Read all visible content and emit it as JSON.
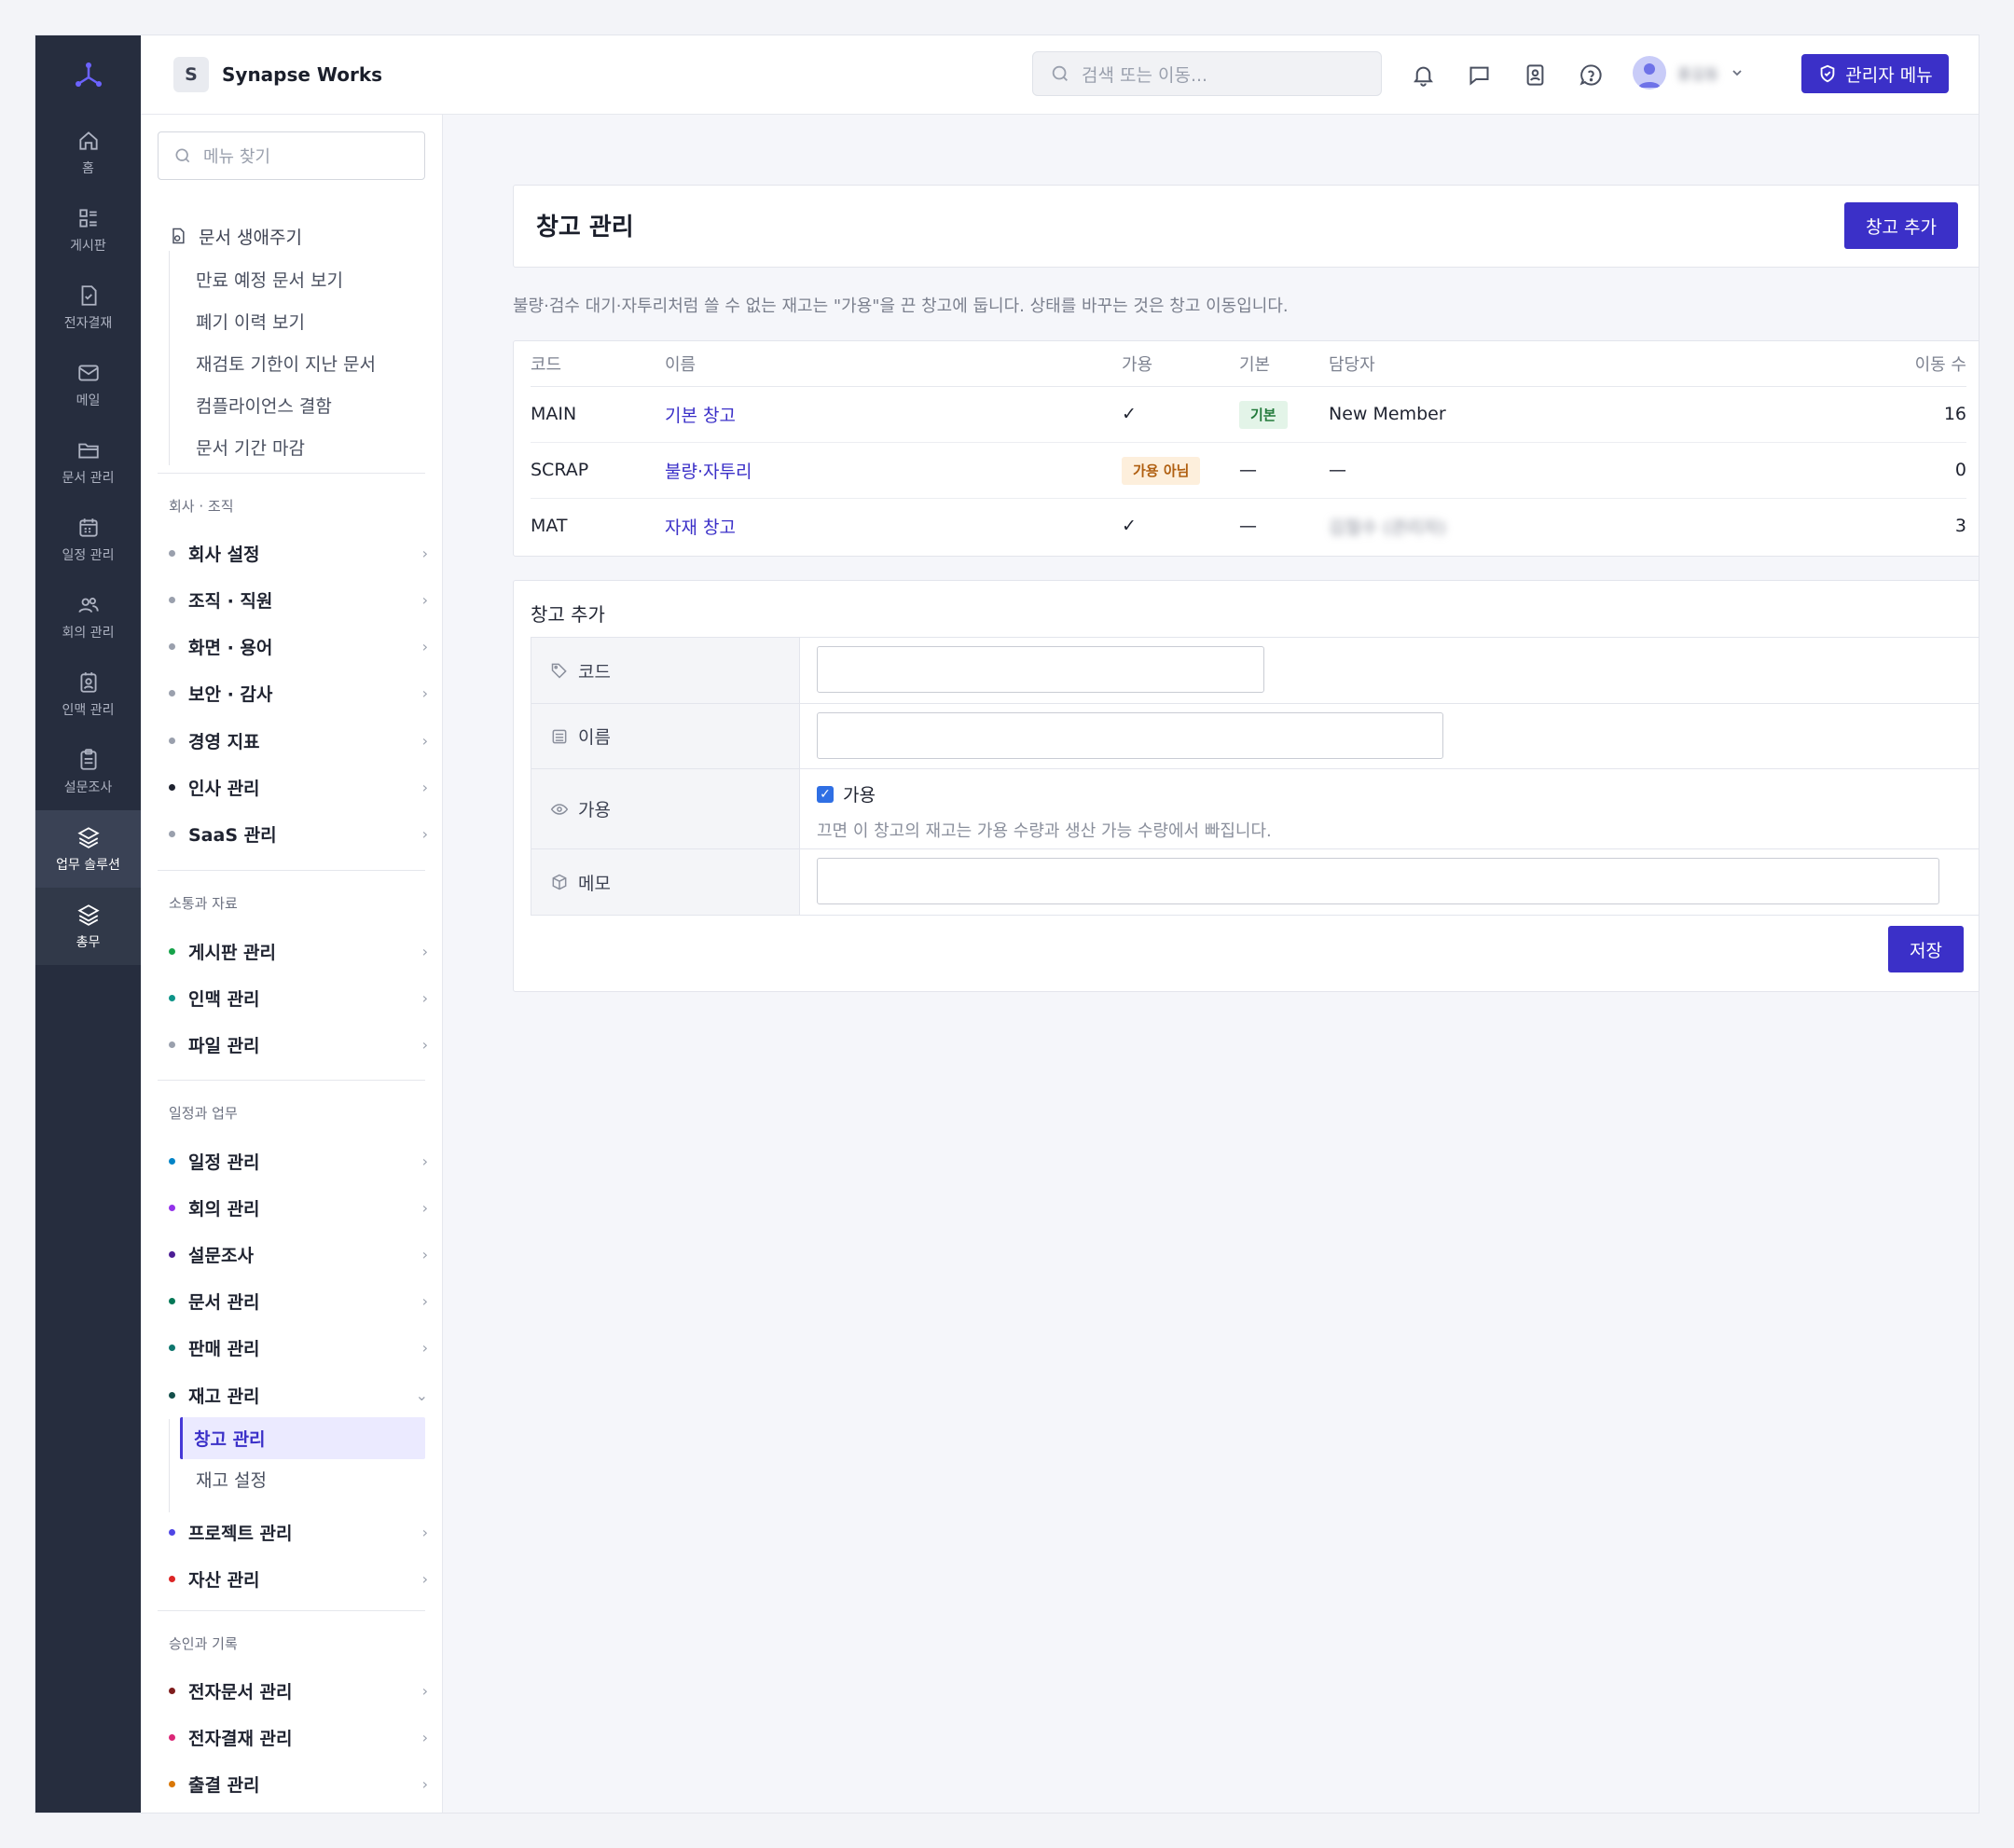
{
  "company": {
    "initial": "S",
    "name": "Synapse Works"
  },
  "search": {
    "placeholder": "검색 또는 이동..."
  },
  "user": {
    "name": "홍길동"
  },
  "admin_button": "관리자 메뉴",
  "rail": [
    {
      "icon": "home-icon",
      "label": "홈"
    },
    {
      "icon": "board-icon",
      "label": "게시판"
    },
    {
      "icon": "approval-icon",
      "label": "전자결재"
    },
    {
      "icon": "mail-icon",
      "label": "메일"
    },
    {
      "icon": "folder-icon",
      "label": "문서 관리"
    },
    {
      "icon": "calendar-icon",
      "label": "일정 관리"
    },
    {
      "icon": "users-icon",
      "label": "회의 관리"
    },
    {
      "icon": "contact-icon",
      "label": "인맥 관리"
    },
    {
      "icon": "clipboard-icon",
      "label": "설문조사"
    },
    {
      "icon": "layers-icon",
      "label": "업무 솔루션"
    },
    {
      "icon": "layers-icon",
      "label": "총무"
    }
  ],
  "menu": {
    "search_placeholder": "메뉴 찾기",
    "lifecycle": {
      "title": "문서 생애주기",
      "items": [
        "만료 예정 문서 보기",
        "폐기 이력 보기",
        "재검토 기한이 지난 문서",
        "컴플라이언스 결함",
        "문서 기간 마감"
      ]
    },
    "groups": [
      {
        "title": "회사 · 조직",
        "items": [
          {
            "label": "회사 설정",
            "color": "#9aa0ad"
          },
          {
            "label": "조직 · 직원",
            "color": "#9aa0ad"
          },
          {
            "label": "화면 · 용어",
            "color": "#9aa0ad"
          },
          {
            "label": "보안 · 감사",
            "color": "#9aa0ad"
          },
          {
            "label": "경영 지표",
            "color": "#9aa0ad"
          },
          {
            "label": "인사 관리",
            "color": "#1f2330"
          },
          {
            "label": "SaaS 관리",
            "color": "#9aa0ad"
          }
        ]
      },
      {
        "title": "소통과 자료",
        "items": [
          {
            "label": "게시판 관리",
            "color": "#16a34a"
          },
          {
            "label": "인맥 관리",
            "color": "#0d9488"
          },
          {
            "label": "파일 관리",
            "color": "#9aa0ad"
          }
        ]
      },
      {
        "title": "일정과 업무",
        "items": [
          {
            "label": "일정 관리",
            "color": "#0284c7"
          },
          {
            "label": "회의 관리",
            "color": "#9333ea"
          },
          {
            "label": "설문조사",
            "color": "#4c1d95"
          },
          {
            "label": "문서 관리",
            "color": "#047857"
          },
          {
            "label": "판매 관리",
            "color": "#0f766e"
          },
          {
            "label": "재고 관리",
            "color": "#134e4a"
          },
          {
            "label": "프로젝트 관리",
            "color": "#4f46e5"
          },
          {
            "label": "자산 관리",
            "color": "#dc2626"
          }
        ]
      },
      {
        "title": "승인과 기록",
        "items": [
          {
            "label": "전자문서 관리",
            "color": "#7f1d1d"
          },
          {
            "label": "전자결재 관리",
            "color": "#db2777"
          },
          {
            "label": "출결 관리",
            "color": "#d97706"
          }
        ]
      }
    ],
    "inventory_sub": [
      "창고 관리",
      "재고 설정"
    ]
  },
  "page": {
    "title": "창고 관리",
    "add_button": "창고 추가",
    "description": "불량·검수 대기·자투리처럼 쓸 수 없는 재고는 \"가용\"을 끈 창고에 둡니다. 상태를 바꾸는 것은 창고 이동입니다."
  },
  "table": {
    "headers": {
      "code": "코드",
      "name": "이름",
      "available": "가용",
      "default": "기본",
      "manager": "담당자",
      "moves": "이동 수"
    },
    "rows": [
      {
        "code": "MAIN",
        "name": "기본 창고",
        "available": "✓",
        "available_badge": "",
        "default": "기본",
        "manager": "New Member",
        "moves": "16"
      },
      {
        "code": "SCRAP",
        "name": "불량·자투리",
        "available": "",
        "available_badge": "가용 아님",
        "default": "—",
        "manager": "—",
        "moves": "0"
      },
      {
        "code": "MAT",
        "name": "자재 창고",
        "available": "✓",
        "available_badge": "",
        "default": "—",
        "manager": "김철수 (관리자)",
        "moves": "3"
      }
    ]
  },
  "form": {
    "title": "창고 추가",
    "code_label": "코드",
    "name_label": "이름",
    "available_label": "가용",
    "available_checkbox": "가용",
    "available_hint": "끄면 이 창고의 재고는 가용 수량과 생산 가능 수량에서 빠집니다.",
    "memo_label": "메모",
    "save_button": "저장"
  }
}
